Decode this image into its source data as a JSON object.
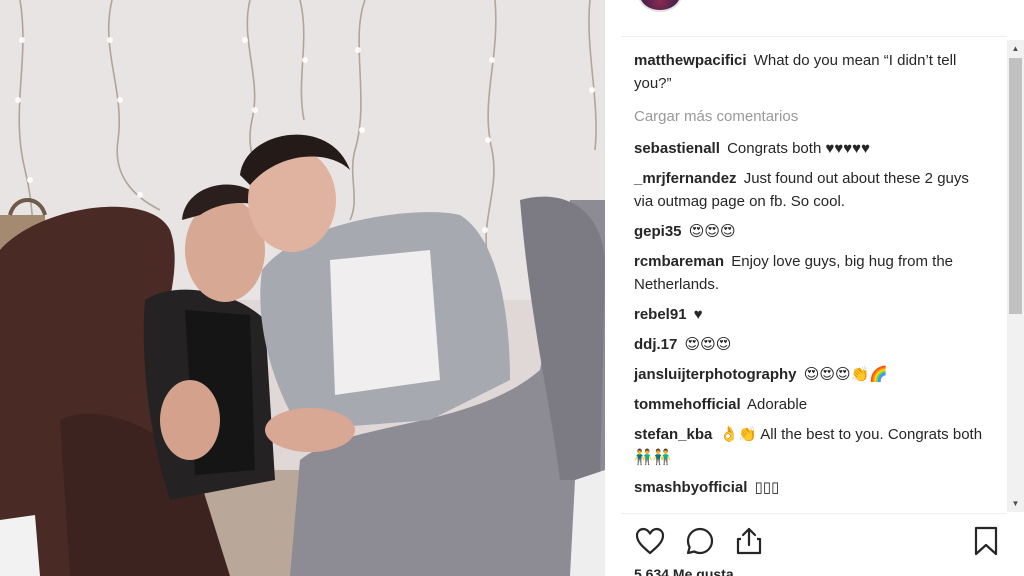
{
  "post": {
    "photo_alt": "Two young men sitting together against a wall with string lights"
  },
  "comments": {
    "first": {
      "user": "matthewpacifici",
      "text": "What do you mean “I didn’t tell you?”"
    },
    "load_more": "Cargar más comentarios",
    "items": [
      {
        "user": "sebastienall",
        "text": "Congrats both ♥♥♥♥♥"
      },
      {
        "user": "_mrjfernandez",
        "text": "Just found out about these 2 guys via outmag page on fb. So cool."
      },
      {
        "user": "gepi35",
        "text": "😍😍😍"
      },
      {
        "user": "rcmbareman",
        "text": "Enjoy love guys, big hug from the Netherlands."
      },
      {
        "user": "rebel91",
        "text": "♥"
      },
      {
        "user": "ddj.17",
        "text": "😍😍😍"
      },
      {
        "user": "jansluijterphotography",
        "text": "😍😍😍👏🌈"
      },
      {
        "user": "tommehofficial",
        "text": "Adorable"
      },
      {
        "user": "stefan_kba",
        "text": "👌👏 All the best to you. Congrats both 👬👬"
      },
      {
        "user": "smashbyofficial",
        "text": "▯▯▯"
      }
    ]
  },
  "actions": {
    "like_icon": "heart-icon",
    "comment_icon": "comment-bubble-icon",
    "share_icon": "share-icon",
    "save_icon": "bookmark-icon"
  },
  "likes": {
    "text": "5.634 Me gusta"
  },
  "scrollbar": {
    "up_glyph": "▲",
    "down_glyph": "▼"
  }
}
